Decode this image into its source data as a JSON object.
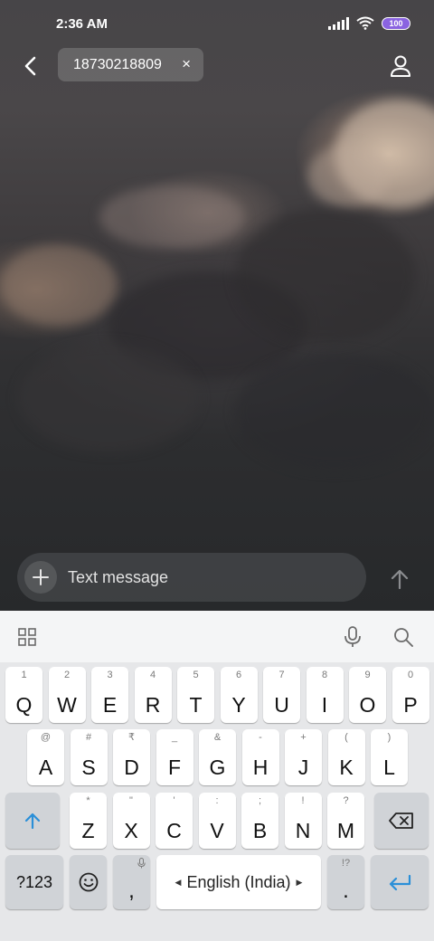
{
  "status_bar": {
    "time": "2:36 AM",
    "battery": "100"
  },
  "header": {
    "recipient": "18730218809",
    "remove_symbol": "×"
  },
  "compose": {
    "placeholder": "Text message"
  },
  "keyboard": {
    "row1": [
      {
        "key": "Q",
        "hint": "1"
      },
      {
        "key": "W",
        "hint": "2"
      },
      {
        "key": "E",
        "hint": "3"
      },
      {
        "key": "R",
        "hint": "4"
      },
      {
        "key": "T",
        "hint": "5"
      },
      {
        "key": "Y",
        "hint": "6"
      },
      {
        "key": "U",
        "hint": "7"
      },
      {
        "key": "I",
        "hint": "8"
      },
      {
        "key": "O",
        "hint": "9"
      },
      {
        "key": "P",
        "hint": "0"
      }
    ],
    "row2": [
      {
        "key": "A",
        "hint": "@"
      },
      {
        "key": "S",
        "hint": "#"
      },
      {
        "key": "D",
        "hint": "₹"
      },
      {
        "key": "F",
        "hint": "_"
      },
      {
        "key": "G",
        "hint": "&"
      },
      {
        "key": "H",
        "hint": "-"
      },
      {
        "key": "J",
        "hint": "+"
      },
      {
        "key": "K",
        "hint": "("
      },
      {
        "key": "L",
        "hint": ")"
      }
    ],
    "row3": [
      {
        "key": "Z",
        "hint": "*"
      },
      {
        "key": "X",
        "hint": "\""
      },
      {
        "key": "C",
        "hint": "'"
      },
      {
        "key": "V",
        "hint": ":"
      },
      {
        "key": "B",
        "hint": ";"
      },
      {
        "key": "N",
        "hint": "!"
      },
      {
        "key": "M",
        "hint": "?"
      }
    ],
    "symbols_label": "?123",
    "comma": ",",
    "space_label": "English (India)",
    "period": ".",
    "period_hint": "!?"
  },
  "colors": {
    "accent": "#2a8fd8",
    "battery": "#8a63e0",
    "keyboard_bg": "#e6e7e9"
  },
  "icons": {
    "back": "chevron-left-icon",
    "contact": "person-icon",
    "attach": "plus-icon",
    "send": "arrow-up-icon",
    "shift": "shift-arrow-icon",
    "backspace": "backspace-icon",
    "enter": "enter-arrow-icon",
    "grid": "grid-icon",
    "mic": "microphone-icon",
    "search": "search-icon",
    "emoji": "emoji-icon"
  }
}
